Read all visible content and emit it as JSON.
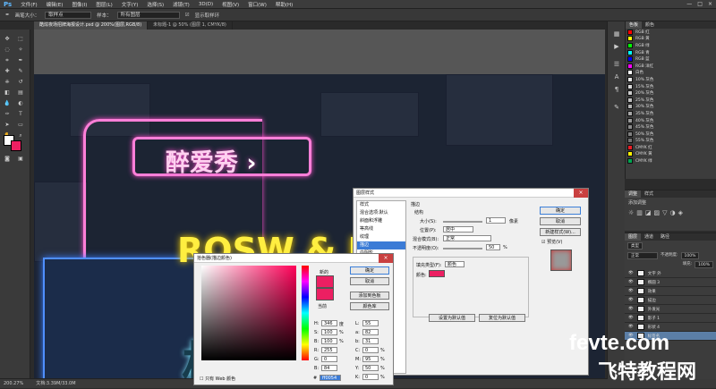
{
  "menu": {
    "logo": "Ps",
    "items": [
      "文件(F)",
      "编辑(E)",
      "图像(I)",
      "图层(L)",
      "文字(Y)",
      "选择(S)",
      "滤镜(T)",
      "3D(D)",
      "视图(V)",
      "窗口(W)",
      "帮助(H)"
    ]
  },
  "window_controls": [
    "—",
    "□",
    "×"
  ],
  "options": {
    "mode_label": "画笔大小：",
    "mode_value": "取样点",
    "sample_label": "样本：",
    "sample_value": "所有图层",
    "show_ring": "显示取样环"
  },
  "doc_tabs": [
    {
      "label": "酷炫夜场招牌海报设计.psd @ 200%(图层,RGB/8)",
      "active": true
    },
    {
      "label": "未标题-1 @ 50% (图层 1, CMYK/8)",
      "active": false
    }
  ],
  "canvas": {
    "sign_cn": "醉爱秀",
    "sign_arrow": "›",
    "sign_en": "ROSW & EC",
    "sign_big": "极"
  },
  "status": {
    "zoom": "200.27%",
    "doc": "文档:3.39M/33.0M"
  },
  "swatch_panel": {
    "tabs": [
      "色板",
      "颜色"
    ],
    "items": [
      {
        "name": "RGB 红",
        "color": "#ff0000"
      },
      {
        "name": "RGB 黄",
        "color": "#ffff00"
      },
      {
        "name": "RGB 绿",
        "color": "#00ff00"
      },
      {
        "name": "RGB 青",
        "color": "#00ffff"
      },
      {
        "name": "RGB 蓝",
        "color": "#0000ff"
      },
      {
        "name": "RGB 洋红",
        "color": "#ff00ff"
      },
      {
        "name": "白色",
        "color": "#ffffff"
      },
      {
        "name": "10% 灰色",
        "color": "#e6e6e6"
      },
      {
        "name": "15% 灰色",
        "color": "#d9d9d9"
      },
      {
        "name": "20% 灰色",
        "color": "#cccccc"
      },
      {
        "name": "25% 灰色",
        "color": "#bfbfbf"
      },
      {
        "name": "30% 灰色",
        "color": "#b3b3b3"
      },
      {
        "name": "35% 灰色",
        "color": "#a6a6a6"
      },
      {
        "name": "40% 灰色",
        "color": "#999999"
      },
      {
        "name": "45% 灰色",
        "color": "#8c8c8c"
      },
      {
        "name": "50% 灰色",
        "color": "#808080"
      },
      {
        "name": "55% 灰色",
        "color": "#737373"
      },
      {
        "name": "CMYK 红",
        "color": "#ed1c24"
      },
      {
        "name": "CMYK 黄",
        "color": "#fff200"
      },
      {
        "name": "CMYK 绿",
        "color": "#00a651"
      }
    ]
  },
  "adjust_panel": {
    "tabs": [
      "调整",
      "样式"
    ],
    "title": "添加调整"
  },
  "layers_panel": {
    "tabs": [
      "图层",
      "通道",
      "路径"
    ],
    "kind": "类型",
    "mode": "正常",
    "opacity_label": "不透明度:",
    "opacity": "100%",
    "fill_label": "填充:",
    "fill": "100%",
    "rows": [
      {
        "name": "文字 外",
        "sel": false
      },
      {
        "name": "椭圆 3",
        "sel": false
      },
      {
        "name": "效果",
        "sel": false
      },
      {
        "name": "描边",
        "sel": false
      },
      {
        "name": "外发光",
        "sel": false
      },
      {
        "name": "影子 1",
        "sel": false
      },
      {
        "name": "形状 4",
        "sel": false
      },
      {
        "name": "标签名",
        "sel": true
      }
    ]
  },
  "style_dialog": {
    "title": "图层样式",
    "list": [
      {
        "label": "样式",
        "sel": false
      },
      {
        "label": "混合选项:默认",
        "sel": false
      },
      {
        "label": "斜面和浮雕",
        "sel": false
      },
      {
        "label": "等高线",
        "sel": false
      },
      {
        "label": "纹理",
        "sel": false
      },
      {
        "label": "描边",
        "sel": true
      },
      {
        "label": "内阴影",
        "sel": false
      },
      {
        "label": "内发光",
        "sel": false
      },
      {
        "label": "光泽",
        "sel": false
      },
      {
        "label": "颜色叠加",
        "sel": false
      },
      {
        "label": "渐变叠加",
        "sel": false
      },
      {
        "label": "图案叠加",
        "sel": false
      },
      {
        "label": "外发光",
        "sel": false
      },
      {
        "label": "投影",
        "sel": false
      }
    ],
    "group": "描边",
    "struct": "结构",
    "size_label": "大小(S):",
    "size": "1",
    "size_unit": "像素",
    "pos_label": "位置(P):",
    "pos": "居中",
    "blend_label": "混合模式(B):",
    "blend": "正常",
    "opac_label": "不透明度(O):",
    "opac": "50",
    "opac_unit": "%",
    "fill_type_label": "填充类型(F):",
    "fill_type": "颜色",
    "color_label": "颜色:",
    "set_default": "设置为默认值",
    "reset_default": "复位为默认值",
    "ok": "确定",
    "cancel": "取消",
    "new_style": "新建样式(W)...",
    "preview": "预览(V)",
    "stroke_color": "#ec1f62"
  },
  "picker": {
    "title": "拾色器(描边颜色)",
    "new_label": "新的",
    "cur_label": "当前",
    "ok": "确定",
    "cancel": "取消",
    "add_swatch": "添加到色板",
    "libraries": "颜色库",
    "fields": [
      [
        "H:",
        "346",
        "度"
      ],
      [
        "S:",
        "100",
        "%"
      ],
      [
        "B:",
        "100",
        "%"
      ],
      [
        "R:",
        "255",
        ""
      ],
      [
        "G:",
        "0",
        ""
      ],
      [
        "B:",
        "84",
        ""
      ]
    ],
    "lab": [
      [
        "L:",
        "55"
      ],
      [
        "a:",
        "82"
      ],
      [
        "b:",
        "31"
      ]
    ],
    "cmyk": [
      [
        "C:",
        "0",
        "%"
      ],
      [
        "M:",
        "95",
        "%"
      ],
      [
        "Y:",
        "50",
        "%"
      ],
      [
        "K:",
        "0",
        "%"
      ]
    ],
    "hex_label": "#",
    "hex": "ff0054",
    "web_only": "只有 Web 颜色",
    "current_color": "#ec1f62"
  },
  "watermark": {
    "site": "fevte.com",
    "cn": "飞特教程网"
  }
}
